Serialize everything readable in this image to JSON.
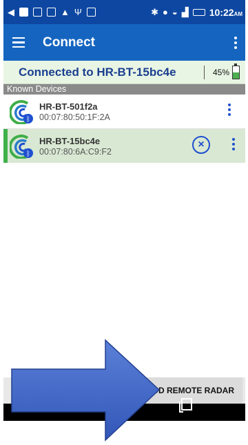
{
  "status_bar": {
    "time": "10:22",
    "ampm": "AM"
  },
  "app_bar": {
    "title": "Connect"
  },
  "connection": {
    "text": "Connected to HR-BT-15bc4e",
    "battery": "45%",
    "battery_level": 0.45
  },
  "known_devices": {
    "header": "Known Devices",
    "items": [
      {
        "name": "HR-BT-501f2a",
        "mac": "00:07:80:50:1F:2A",
        "selected": false
      },
      {
        "name": "HR-BT-15bc4e",
        "mac": "00:07:80:6A:C9:F2",
        "selected": true
      }
    ],
    "disconnect_glyph": "×"
  },
  "actions": {
    "add_remote_radar": "ADD REMOTE RADAR"
  },
  "icons": {
    "status_left": [
      "back-arrow-icon",
      "gmail-icon",
      "image-icon",
      "image-icon",
      "warning-icon",
      "usb-icon",
      "screen-icon"
    ],
    "status_right": [
      "bluetooth-icon",
      "do-not-disturb-icon",
      "wifi-icon",
      "signal-icon",
      "battery-icon"
    ],
    "menu": "hamburger-menu-icon",
    "overflow": "more-vert-icon",
    "device": "radar-bluetooth-icon",
    "annotation": "blue-arrow-icon"
  },
  "colors": {
    "status_bar": "#0d47a1",
    "app_bar": "#1565c0",
    "connected_banner": "#e9f5e4",
    "connected_text": "#1a3f8f",
    "selected_row": "#d9e8d3",
    "selected_accent": "#3fb14a",
    "action_blue": "#1e4fd0",
    "arrow_fill": "#3f68c9"
  }
}
